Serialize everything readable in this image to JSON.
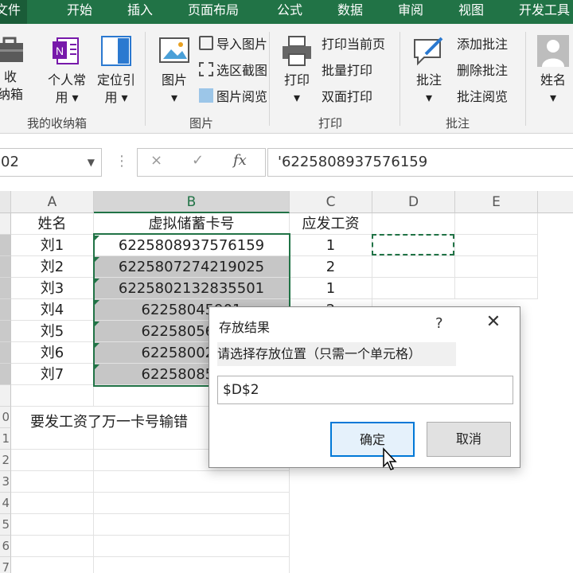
{
  "tabs": [
    "文件",
    "开始",
    "插入",
    "页面布局",
    "公式",
    "数据",
    "审阅",
    "视图",
    "开发工具"
  ],
  "ribbon": {
    "groups": [
      {
        "label": "我的收纳箱",
        "buttons": [
          "收\n纳箱",
          "个人常\n用 ▾",
          "定位引\n用 ▾"
        ]
      },
      {
        "label": "图片",
        "big": "图片\n▾",
        "small": [
          "导入图片",
          "选区截图",
          "图片阅览"
        ]
      },
      {
        "label": "打印",
        "big": "打印\n▾",
        "small": [
          "打印当前页",
          "批量打印",
          "双面打印"
        ]
      },
      {
        "label": "批注",
        "big": "批注\n▾",
        "small": [
          "添加批注",
          "删除批注",
          "批注阅览"
        ]
      },
      {
        "label": "",
        "big": "姓名\n▾"
      }
    ]
  },
  "formula_bar": {
    "name_box": "02",
    "cancel_icon": "×",
    "enter_icon": "✓",
    "fx": "fx",
    "formula": "'6225808937576159"
  },
  "sheet": {
    "columns": [
      "A",
      "B",
      "C",
      "D",
      "E"
    ],
    "header_row": {
      "a": "姓名",
      "b": "虚拟储蓄卡号",
      "c": "应发工资"
    },
    "rows": [
      {
        "a": "刘1",
        "b": "6225808937576159",
        "c": "1"
      },
      {
        "a": "刘2",
        "b": "6225807274219025",
        "c": "2"
      },
      {
        "a": "刘3",
        "b": "6225802132835501",
        "c": "1"
      },
      {
        "a": "刘4",
        "b": "62258045901",
        "c": "2"
      },
      {
        "a": "刘5",
        "b": "62258056540",
        "c": ""
      },
      {
        "a": "刘6",
        "b": "62258002027",
        "c": ""
      },
      {
        "a": "刘7",
        "b": "62258085840",
        "c": ""
      }
    ],
    "row_numbers": [
      "",
      "",
      "",
      "",
      "",
      "",
      "",
      "",
      "0",
      "1",
      "2",
      "3",
      "4",
      "5",
      "6",
      "7"
    ],
    "note": "要发工资了万一卡号输错"
  },
  "dialog": {
    "title": "存放结果",
    "help": "?",
    "close": "✕",
    "prompt": "请选择存放位置（只需一个单元格）",
    "value": "$D$2",
    "ok": "确定",
    "cancel": "取消"
  }
}
